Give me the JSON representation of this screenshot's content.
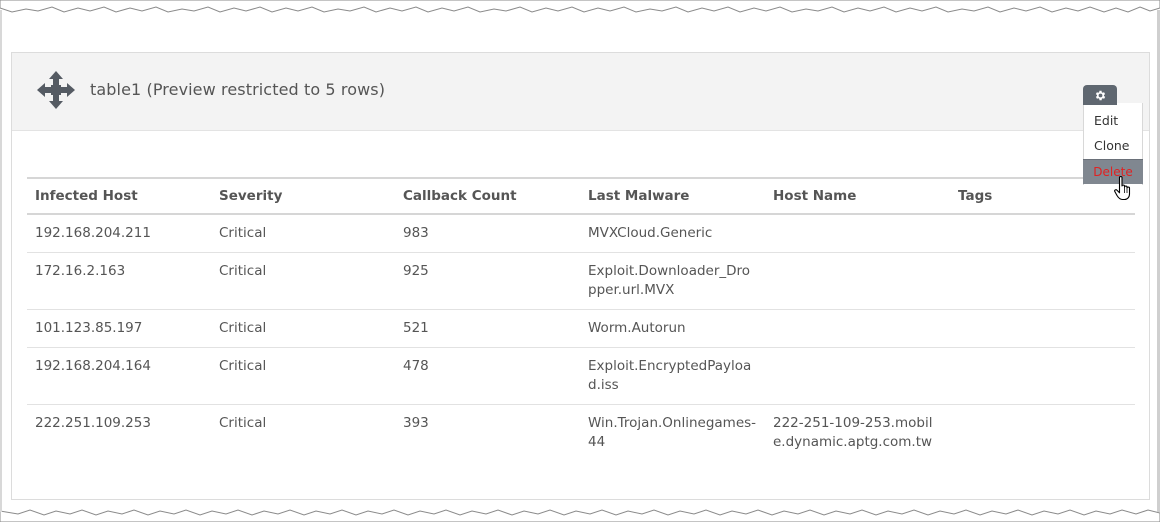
{
  "panel": {
    "title": "table1 (Preview restricted to 5 rows)"
  },
  "menu": {
    "edit": "Edit",
    "clone": "Clone",
    "delete": "Delete"
  },
  "table": {
    "headers": [
      "Infected Host",
      "Severity",
      "Callback Count",
      "Last Malware",
      "Host Name",
      "Tags"
    ],
    "rows": [
      [
        "192.168.204.211",
        "Critical",
        "983",
        "MVXCloud.Generic",
        "",
        ""
      ],
      [
        "172.16.2.163",
        "Critical",
        "925",
        "Exploit.Downloader_Dropper.url.MVX",
        "",
        ""
      ],
      [
        "101.123.85.197",
        "Critical",
        "521",
        "Worm.Autorun",
        "",
        ""
      ],
      [
        "192.168.204.164",
        "Critical",
        "478",
        "Exploit.EncryptedPayload.iss",
        "",
        ""
      ],
      [
        "222.251.109.253",
        "Critical",
        "393",
        "Win.Trojan.Onlinegames-44",
        "222-251-109-253.mobile.dynamic.aptg.com.tw",
        ""
      ]
    ]
  },
  "colors": {
    "header_bg": "#f3f3f3",
    "gear_bg": "#5f6770",
    "delete_bg": "#808790",
    "delete_text": "#e02222"
  },
  "icons": [
    "move-icon",
    "gear-icon",
    "hand-cursor-icon"
  ]
}
